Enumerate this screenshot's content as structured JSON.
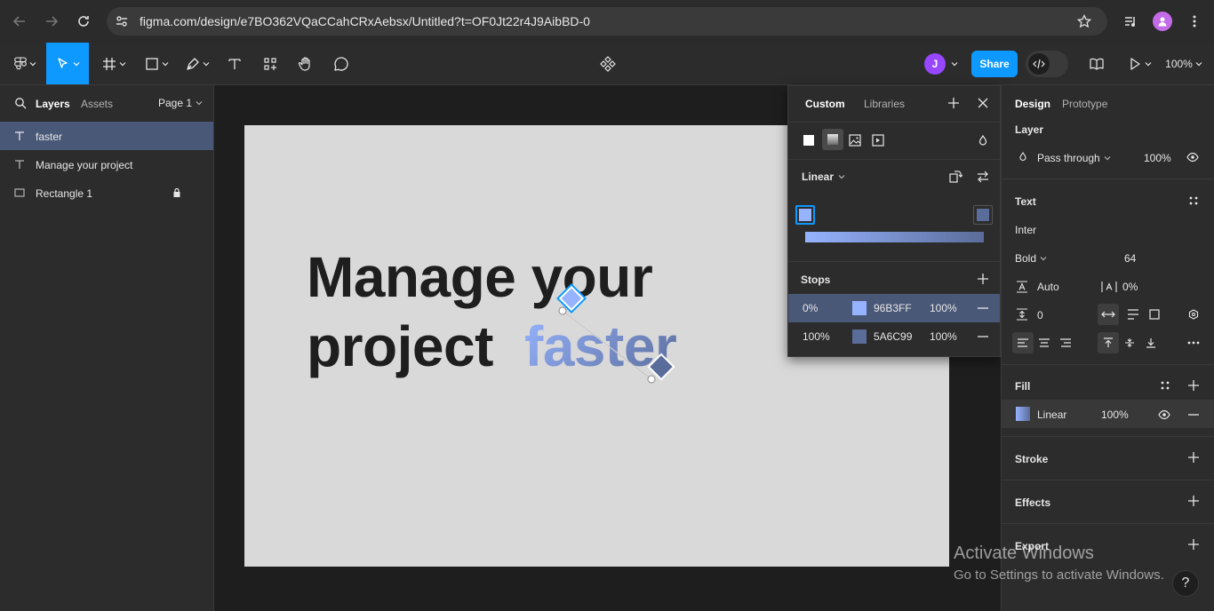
{
  "browser": {
    "url": "figma.com/design/e7BO362VQaCCahCRxAebsx/Untitled?t=OF0Jt22r4J9AibBD-0"
  },
  "toolbar": {
    "avatar_initial": "J",
    "share_label": "Share",
    "zoom_label": "100%"
  },
  "left_panel": {
    "tabs": {
      "layers": "Layers",
      "assets": "Assets"
    },
    "page_label": "Page 1",
    "layers": [
      {
        "name": "faster",
        "type": "text",
        "selected": true
      },
      {
        "name": "Manage your project",
        "type": "text",
        "selected": false
      },
      {
        "name": "Rectangle 1",
        "type": "rectangle",
        "locked": true,
        "selected": false
      }
    ]
  },
  "canvas": {
    "line1": "Manage your",
    "line2": "project",
    "line3": "faster"
  },
  "fill_picker": {
    "tabs": {
      "custom": "Custom",
      "libraries": "Libraries"
    },
    "gradient_type": "Linear",
    "stops_label": "Stops",
    "stops": [
      {
        "position": "0%",
        "hex": "96B3FF",
        "opacity": "100%",
        "color": "#96B3FF",
        "selected": true
      },
      {
        "position": "100%",
        "hex": "5A6C99",
        "opacity": "100%",
        "color": "#5A6C99",
        "selected": false
      }
    ]
  },
  "right_panel": {
    "tabs": {
      "design": "Design",
      "prototype": "Prototype"
    },
    "layer": {
      "title": "Layer",
      "blend": "Pass through",
      "opacity": "100%"
    },
    "text": {
      "title": "Text",
      "font_family": "Inter",
      "font_weight": "Bold",
      "font_size": "64",
      "line_height": "Auto",
      "letter_spacing": "0%",
      "paragraph_spacing": "0"
    },
    "fill": {
      "title": "Fill",
      "type": "Linear",
      "opacity": "100%"
    },
    "stroke": {
      "title": "Stroke"
    },
    "effects": {
      "title": "Effects"
    },
    "export": {
      "title": "Export"
    }
  },
  "windows_notice": {
    "title": "Activate Windows",
    "subtitle": "Go to Settings to activate Windows."
  },
  "colors": {
    "accent": "#0d99ff",
    "selection": "#4a5878",
    "avatar": "#9747ff",
    "gradient_start": "#96B3FF",
    "gradient_end": "#5A6C99"
  }
}
